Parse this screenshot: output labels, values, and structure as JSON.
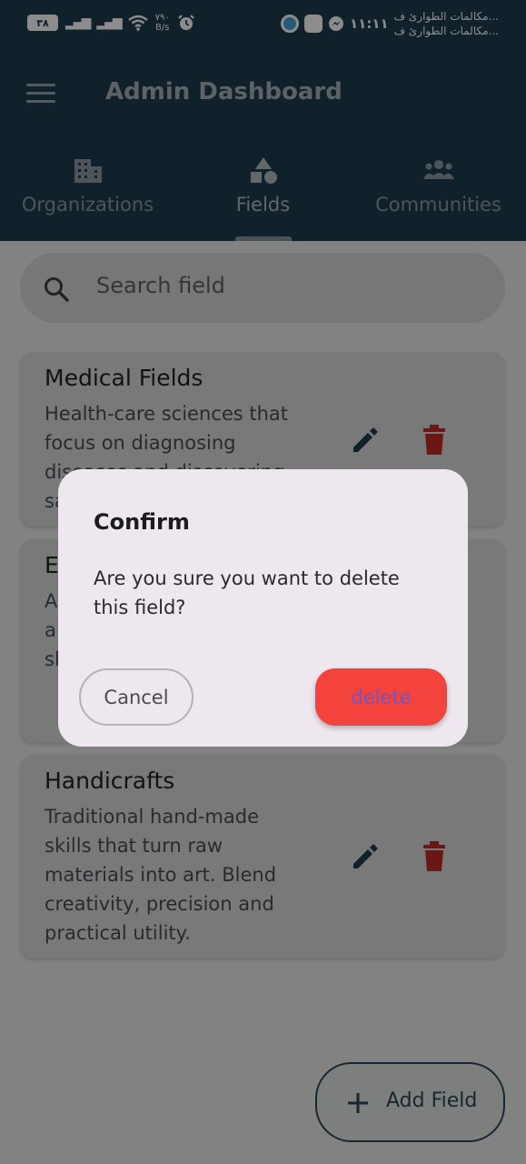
{
  "status_bar": {
    "battery": "٣٨",
    "net_speed_value": "٧٩٠",
    "net_speed_unit": "B/s",
    "clock": "١١:١١",
    "notification_line1": "مكالمات الطوارئ ف...",
    "notification_line2": "مكالمات الطوارئ ف..."
  },
  "app_bar": {
    "title": "Admin Dashboard",
    "menu_icon": "hamburger-menu-icon"
  },
  "tabs": [
    {
      "label": "Organizations",
      "icon": "building-icon",
      "active": false
    },
    {
      "label": "Fields",
      "icon": "shapes-icon",
      "active": true
    },
    {
      "label": "Communities",
      "icon": "groups-icon",
      "active": false
    }
  ],
  "search": {
    "placeholder": "Search field",
    "icon": "search-icon"
  },
  "fields": [
    {
      "title": "Medical Fields",
      "description": "Health-care sciences that focus on diagnosing diseases and discovering safe"
    },
    {
      "title": "E",
      "description": "A p a fr sl"
    },
    {
      "title": "Handicrafts",
      "description": "Traditional hand-made skills that turn raw materials into art. Blend creativity, precision and practical utility."
    }
  ],
  "fab": {
    "label": "Add Field",
    "icon": "plus-icon"
  },
  "dialog": {
    "title": "Confirm",
    "message": "Are you sure you want to delete this field?",
    "cancel_label": "Cancel",
    "delete_label": "delete"
  },
  "colors": {
    "app_bar": "#1f3d4f",
    "edit_icon": "#1f3d4f",
    "delete_icon": "#d32f2f",
    "delete_button": "#f4433c",
    "dialog_bg": "#efe7f0"
  }
}
